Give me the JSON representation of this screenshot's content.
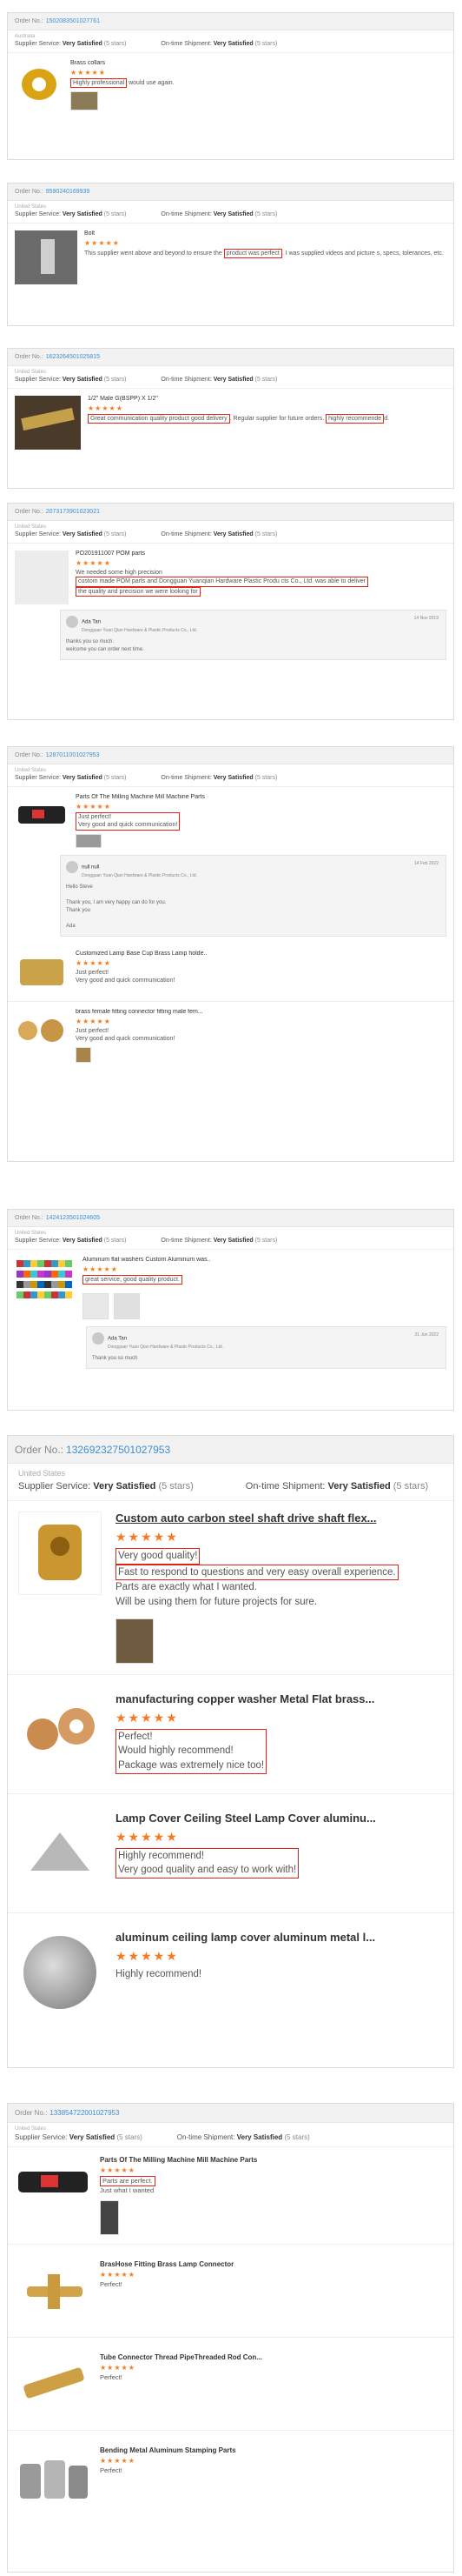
{
  "order_label": "Order No.:",
  "svc_label": "Supplier Service:",
  "ship_label": "On-time Shipment:",
  "very_satisfied": "Very Satisfied",
  "five_stars": "(5 stars)",
  "stars": "★★★★★",
  "orders": [
    {
      "number": "1502083501027761",
      "country": "Australia",
      "items": [
        {
          "title": "Brass collars",
          "comment_hl": "Highly professional",
          "comment": " would use again."
        }
      ]
    },
    {
      "number": "9590240169939",
      "country": "United States",
      "items": [
        {
          "title": "Bolt",
          "comment_pre": "This supplier went above and beyond to ensure the ",
          "comment_hl": "product was perfect",
          "comment": ". I was supplied videos and picture s, specs, tolerances, etc."
        }
      ]
    },
    {
      "number": "1623264501025815",
      "country": "United States",
      "items": [
        {
          "title": "1/2\" Male G(BSPP) X 1/2\"",
          "comment_hl": "Great communication quality product good delivery",
          "comment": ". Regular supplier for future orders. ",
          "comment_hl2": "highly recommende",
          "comment_tail": "d."
        }
      ]
    },
    {
      "number": "2073173901023021",
      "country": "United States",
      "items": [
        {
          "title": "PO201911007 POM parts",
          "comment_pre": "We needed some high precision ",
          "comment_hl": "custom made POM parts and Dongguan Yuanqian Hardware Plastic Produ cts Co., Ltd. was able to deliver",
          "comment": " ",
          "comment_hl2": "the quality and precision we were looking for",
          "comment_tail": "."
        }
      ],
      "reply": {
        "name": "Ada Tan",
        "company": "Dongguan Yuan Qian Hardware & Plastic Products Co., Ltd.",
        "date": "14 Nov 2019",
        "text1": "thanks you so much.",
        "text2": "welcome you can order next time."
      }
    },
    {
      "number": "1287011001027953",
      "country": "United States",
      "items": [
        {
          "title": "Parts Of The Milling Machine Mill Machine Parts",
          "comment_hl": "Just perfect!",
          "comment2": "Very good and quick communication!"
        },
        {
          "title": "Customized Lamp Base Cup Brass Lamp holde..",
          "comment": "Just perfect!",
          "comment2": "Very good and quick communication!"
        },
        {
          "title": "brass female fitting connector fitting male fem...",
          "comment": "Just perfect!",
          "comment2": "Very good and quick communication!"
        }
      ],
      "reply": {
        "name": "null null",
        "company": "Dongguan Yuan Qian Hardware & Plastic Products Co., Ltd.",
        "date": "14 Feb 2022",
        "text1": "Hello Steve",
        "text2": "Thank you, I am very happy can do for you.",
        "text3": "Thank you",
        "text4": "Ada"
      }
    },
    {
      "number": "1424123501024605",
      "country": "United States",
      "items": [
        {
          "title": "Aluminum flat washers Custom Aluminum was..",
          "comment_hl": "great service, good quality product."
        }
      ],
      "reply": {
        "name": "Ada Tan",
        "company": "Dongguan Yuan Qian Hardware & Plastic Products Co., Ltd.",
        "date": "21 Jun 2022",
        "text1": "Thank you so much"
      }
    },
    {
      "number": "132692327501027953",
      "country": "United States",
      "items": [
        {
          "title": "Custom auto carbon steel shaft drive shaft flex...",
          "l1": "Very good quality!",
          "l2": "Fast to respond to questions and very easy overall experience.",
          "l3": "Parts are exactly what I wanted.",
          "l4": "Will be using them for future projects for sure."
        },
        {
          "title": "manufacturing copper washer Metal Flat brass...",
          "l1": "Perfect!",
          "l2": "Would highly recommend!",
          "l3": "Package was extremely nice too!"
        },
        {
          "title": "Lamp Cover Ceiling Steel Lamp Cover aluminu...",
          "l1": "Highly recommend!",
          "l2": "Very good quality and easy to work with!"
        },
        {
          "title": "aluminum ceiling lamp cover aluminum metal l...",
          "l1": "Highly recommend!"
        }
      ]
    },
    {
      "number": "133854722001027953",
      "country": "United States",
      "items": [
        {
          "title": "Parts Of The Milling Machine Mill Machine Parts",
          "l1": "Parts are perfect.",
          "l2": "Just what I wanted"
        },
        {
          "title": "BrasHose Fitting Brass Lamp Connector",
          "l1": "Perfect!"
        },
        {
          "title": "Tube Connector Thread PipeThreaded Rod Con...",
          "l1": "Perfect!"
        },
        {
          "title": "Bending Metal Aluminum Stamping Parts",
          "l1": "Perfect!"
        }
      ]
    }
  ]
}
